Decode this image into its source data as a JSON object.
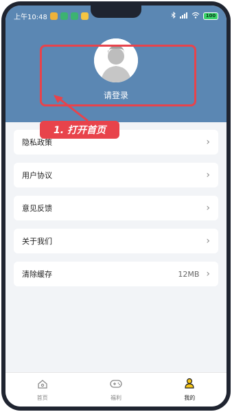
{
  "status_bar": {
    "time": "上午10:48",
    "battery": "100"
  },
  "profile": {
    "login_text": "请登录"
  },
  "annotation": {
    "step_label": "1. 打开首页"
  },
  "menu": {
    "items": [
      {
        "label": "隐私政策",
        "value": ""
      },
      {
        "label": "用户协议",
        "value": ""
      },
      {
        "label": "意见反馈",
        "value": ""
      },
      {
        "label": "关于我们",
        "value": ""
      },
      {
        "label": "清除缓存",
        "value": "12MB"
      }
    ]
  },
  "tabbar": {
    "tabs": [
      {
        "label": "首页",
        "icon": "home-icon"
      },
      {
        "label": "福利",
        "icon": "gamepad-icon"
      },
      {
        "label": "我的",
        "icon": "user-icon"
      }
    ],
    "active": "我的"
  },
  "colors": {
    "header": "#5b87b3",
    "annotation": "#e8434b",
    "background": "#f2f4f7"
  }
}
